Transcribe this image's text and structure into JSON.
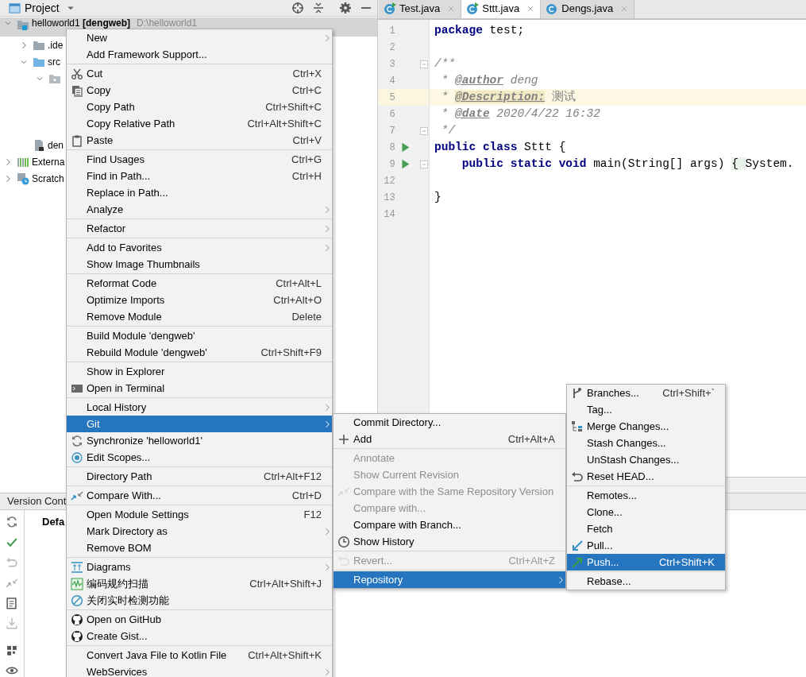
{
  "project_panel": {
    "title": "Project",
    "tree": [
      {
        "kind": "module",
        "label": "helloworld1 **[dengweb]**",
        "path": "D:\\helloworld1",
        "expanded": true,
        "selected": true,
        "children": [
          {
            "kind": "folder",
            "label": ".ide",
            "expanded": false,
            "selected": false
          },
          {
            "kind": "source_folder",
            "label": "src",
            "expanded": true,
            "selected": false,
            "children": [
              {
                "kind": "package",
                "expanded": true,
                "selected": false
              }
            ]
          },
          {
            "kind": "module_file",
            "label": "den",
            "selected": false
          }
        ]
      },
      {
        "kind": "libraries",
        "label": "Externa",
        "expanded": false,
        "selected": false
      },
      {
        "kind": "scratches",
        "label": "Scratch",
        "expanded": false,
        "selected": false
      }
    ]
  },
  "editor": {
    "tabs": [
      {
        "label": "Test.java",
        "selected": false,
        "runnable": true
      },
      {
        "label": "Sttt.java",
        "selected": true,
        "runnable": true
      },
      {
        "label": "Dengs.java",
        "selected": false,
        "runnable": false
      }
    ],
    "lines": [
      {
        "number": "1",
        "current": false,
        "runnable": false,
        "fold": false,
        "spans": [
          {
            "kind": "keyword",
            "text": "package"
          },
          {
            "kind": "plain",
            "text": " test;"
          }
        ]
      },
      {
        "number": "2",
        "current": false,
        "runnable": false,
        "fold": false
      },
      {
        "number": "3",
        "current": false,
        "runnable": false,
        "fold": true,
        "spans": [
          {
            "kind": "comment",
            "text": "/**"
          }
        ]
      },
      {
        "number": "4",
        "current": false,
        "runnable": false,
        "fold": false,
        "spans": [
          {
            "kind": "comment",
            "text": " * "
          },
          {
            "kind": "doc_tag",
            "text": "@author"
          },
          {
            "kind": "comment",
            "text": " deng"
          }
        ]
      },
      {
        "number": "5",
        "current": true,
        "runnable": false,
        "fold": false,
        "spans": [
          {
            "kind": "comment",
            "text": " * "
          },
          {
            "kind": "unknown_tag",
            "text": "@Description:"
          },
          {
            "kind": "comment_text",
            "text": " 测试"
          }
        ]
      },
      {
        "number": "6",
        "current": false,
        "runnable": false,
        "fold": false,
        "spans": [
          {
            "kind": "comment",
            "text": " * "
          },
          {
            "kind": "doc_tag",
            "text": "@date"
          },
          {
            "kind": "comment",
            "text": " 2020/4/22 16:32"
          }
        ]
      },
      {
        "number": "7",
        "current": false,
        "runnable": false,
        "fold": true,
        "spans": [
          {
            "kind": "comment",
            "text": " */"
          }
        ]
      },
      {
        "number": "8",
        "current": false,
        "runnable": true,
        "fold": false,
        "spans": [
          {
            "kind": "keyword",
            "text": "public class"
          },
          {
            "kind": "plain",
            "text": " Sttt {"
          }
        ]
      },
      {
        "number": "9",
        "current": false,
        "runnable": true,
        "fold": true,
        "spans": [
          {
            "kind": "keyword",
            "text": "    public static void"
          },
          {
            "kind": "plain",
            "text": " main(String[] args) "
          },
          {
            "kind": "folded",
            "text": "{ "
          },
          {
            "kind": "plain",
            "text": "System."
          }
        ]
      },
      {
        "number": "12",
        "current": false,
        "runnable": false,
        "fold": false
      },
      {
        "number": "13",
        "current": false,
        "runnable": false,
        "fold": false,
        "spans": [
          {
            "kind": "plain",
            "text": "}"
          }
        ]
      },
      {
        "number": "14",
        "current": false,
        "runnable": false,
        "fold": false
      }
    ]
  },
  "version_control": {
    "title": "Version Cont",
    "content": "Defa"
  },
  "context_menu": {
    "groups": [
      [
        {
          "label": "New",
          "submenu": true,
          "selected": false
        },
        {
          "label": "Add Framework Support...",
          "submenu": false,
          "selected": false
        }
      ],
      [
        {
          "label": "Cut",
          "shortcut": "Ctrl+X",
          "submenu": false,
          "selected": false
        },
        {
          "label": "Copy",
          "shortcut": "Ctrl+C",
          "submenu": false,
          "selected": false
        },
        {
          "label": "Copy Path",
          "shortcut": "Ctrl+Shift+C",
          "submenu": false,
          "selected": false
        },
        {
          "label": "Copy Relative Path",
          "shortcut": "Ctrl+Alt+Shift+C",
          "submenu": false,
          "selected": false
        },
        {
          "label": "Paste",
          "shortcut": "Ctrl+V",
          "submenu": false,
          "selected": false
        }
      ],
      [
        {
          "label": "Find Usages",
          "shortcut": "Ctrl+G",
          "submenu": false,
          "selected": false
        },
        {
          "label": "Find in Path...",
          "shortcut": "Ctrl+H",
          "submenu": false,
          "selected": false
        },
        {
          "label": "Replace in Path...",
          "submenu": false,
          "selected": false
        },
        {
          "label": "Analyze",
          "submenu": true,
          "selected": false
        }
      ],
      [
        {
          "label": "Refactor",
          "submenu": true,
          "selected": false
        }
      ],
      [
        {
          "label": "Add to Favorites",
          "submenu": true,
          "selected": false
        },
        {
          "label": "Show Image Thumbnails",
          "submenu": false,
          "selected": false
        }
      ],
      [
        {
          "label": "Reformat Code",
          "shortcut": "Ctrl+Alt+L",
          "submenu": false,
          "selected": false
        },
        {
          "label": "Optimize Imports",
          "shortcut": "Ctrl+Alt+O",
          "submenu": false,
          "selected": false
        },
        {
          "label": "Remove Module",
          "shortcut": "Delete",
          "submenu": false,
          "selected": false
        }
      ],
      [
        {
          "label": "Build Module 'dengweb'",
          "submenu": false,
          "selected": false
        },
        {
          "label": "Rebuild Module 'dengweb'",
          "shortcut": "Ctrl+Shift+F9",
          "submenu": false,
          "selected": false
        }
      ],
      [
        {
          "label": "Show in Explorer",
          "submenu": false,
          "selected": false
        },
        {
          "label": "Open in Terminal",
          "submenu": false,
          "selected": false
        }
      ],
      [
        {
          "label": "Local History",
          "submenu": true,
          "selected": false
        },
        {
          "label": "Git",
          "submenu": true,
          "selected": true
        },
        {
          "label": "Synchronize 'helloworld1'",
          "submenu": false,
          "selected": false
        },
        {
          "label": "Edit Scopes...",
          "submenu": false,
          "selected": false
        }
      ],
      [
        {
          "label": "Directory Path",
          "shortcut": "Ctrl+Alt+F12",
          "submenu": false,
          "selected": false
        }
      ],
      [
        {
          "label": "Compare With...",
          "shortcut": "Ctrl+D",
          "submenu": false,
          "selected": false
        }
      ],
      [
        {
          "label": "Open Module Settings",
          "shortcut": "F12",
          "submenu": false,
          "selected": false
        },
        {
          "label": "Mark Directory as",
          "submenu": true,
          "selected": false
        },
        {
          "label": "Remove BOM",
          "submenu": false,
          "selected": false
        }
      ],
      [
        {
          "label": "Diagrams",
          "submenu": true,
          "selected": false
        },
        {
          "label": "编码规约扫描",
          "shortcut": "Ctrl+Alt+Shift+J",
          "submenu": false,
          "selected": false
        },
        {
          "label": "关闭实时检测功能",
          "submenu": false,
          "selected": false
        }
      ],
      [
        {
          "label": "Open on GitHub",
          "submenu": false,
          "selected": false
        },
        {
          "label": "Create Gist...",
          "submenu": false,
          "selected": false
        }
      ],
      [
        {
          "label": "Convert Java File to Kotlin File",
          "shortcut": "Ctrl+Alt+Shift+K",
          "submenu": false,
          "selected": false
        },
        {
          "label": "WebServices",
          "submenu": true,
          "selected": false
        }
      ]
    ]
  },
  "git_submenu": {
    "groups": [
      [
        {
          "label": "Commit Directory...",
          "submenu": false,
          "selected": false,
          "disabled": false
        },
        {
          "label": "Add",
          "shortcut": "Ctrl+Alt+A",
          "submenu": false,
          "selected": false,
          "disabled": false
        }
      ],
      [
        {
          "label": "Annotate",
          "submenu": false,
          "selected": false,
          "disabled": true
        },
        {
          "label": "Show Current Revision",
          "submenu": false,
          "selected": false,
          "disabled": true
        },
        {
          "label": "Compare with the Same Repository Version",
          "submenu": false,
          "selected": false,
          "disabled": true
        },
        {
          "label": "Compare with...",
          "submenu": false,
          "selected": false,
          "disabled": true
        },
        {
          "label": "Compare with Branch...",
          "submenu": false,
          "selected": false,
          "disabled": false
        },
        {
          "label": "Show History",
          "submenu": false,
          "selected": false,
          "disabled": false
        }
      ],
      [
        {
          "label": "Revert...",
          "shortcut": "Ctrl+Alt+Z",
          "submenu": false,
          "selected": false,
          "disabled": true
        }
      ],
      [
        {
          "label": "Repository",
          "submenu": true,
          "selected": true,
          "disabled": false
        }
      ]
    ]
  },
  "repository_submenu": {
    "groups": [
      [
        {
          "label": "Branches...",
          "shortcut": "Ctrl+Shift+`",
          "submenu": false,
          "selected": false
        },
        {
          "label": "Tag...",
          "submenu": false,
          "selected": false
        },
        {
          "label": "Merge Changes...",
          "submenu": false,
          "selected": false
        },
        {
          "label": "Stash Changes...",
          "submenu": false,
          "selected": false
        },
        {
          "label": "UnStash Changes...",
          "submenu": false,
          "selected": false
        },
        {
          "label": "Reset HEAD...",
          "submenu": false,
          "selected": false
        }
      ],
      [
        {
          "label": "Remotes...",
          "submenu": false,
          "selected": false
        },
        {
          "label": "Clone...",
          "submenu": false,
          "selected": false
        },
        {
          "label": "Fetch",
          "submenu": false,
          "selected": false
        },
        {
          "label": "Pull...",
          "submenu": false,
          "selected": false
        },
        {
          "label": "Push...",
          "shortcut": "Ctrl+Shift+K",
          "submenu": false,
          "selected": true
        }
      ],
      [
        {
          "label": "Rebase...",
          "submenu": false,
          "selected": false
        }
      ]
    ]
  }
}
